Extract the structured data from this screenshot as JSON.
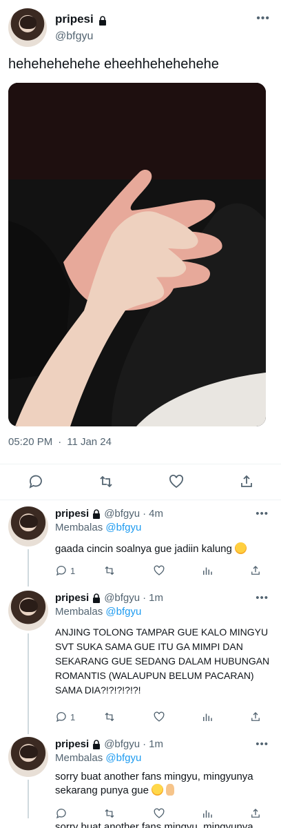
{
  "main_tweet": {
    "display_name": "pripesi",
    "handle": "@bfgyu",
    "more": "•••",
    "text": "hehehehehehe eheehhehehehehe",
    "time": "05:20 PM",
    "separator": "·",
    "date": "11 Jan 24",
    "actions": [
      "reply-icon",
      "retweet-icon",
      "like-icon",
      "share-icon"
    ]
  },
  "replies": [
    {
      "display_name": "pripesi",
      "handle": "@bfgyu",
      "dot": "·",
      "age": "4m",
      "more": "•••",
      "replying_label": "Membalas",
      "replying_to": "@bfgyu",
      "text": "gaada cincin soalnya gue jadiin kalung",
      "emoji": "smiling-face-with-hearts",
      "reply_count": "1"
    },
    {
      "display_name": "pripesi",
      "handle": "@bfgyu",
      "dot": "·",
      "age": "1m",
      "more": "•••",
      "replying_label": "Membalas",
      "replying_to": "@bfgyu",
      "text": "ANJING TOLONG TAMPAR GUE KALO MINGYU SVT SUKA SAMA GUE ITU GA MIMPI DAN SEKARANG GUE SEDANG DALAM HUBUNGAN ROMANTIS (WALAUPUN BELUM PACARAN) SAMA DIA?!?!?!?!?!",
      "reply_count": "1"
    },
    {
      "display_name": "pripesi",
      "handle": "@bfgyu",
      "dot": "·",
      "age": "1m",
      "more": "•••",
      "replying_label": "Membalas",
      "replying_to": "@bfgyu",
      "text": "sorry buat another fans mingyu, mingyunya sekarang punya gue",
      "emoji": "smiling-face-and-pointing-hand",
      "reply_count": ""
    }
  ],
  "partial_text": "sorry buat another fans mingyu, mingyunya",
  "colors": {
    "text": "#0f1419",
    "secondary": "#536471",
    "link": "#1d9bf0",
    "divider": "#eff3f4"
  }
}
